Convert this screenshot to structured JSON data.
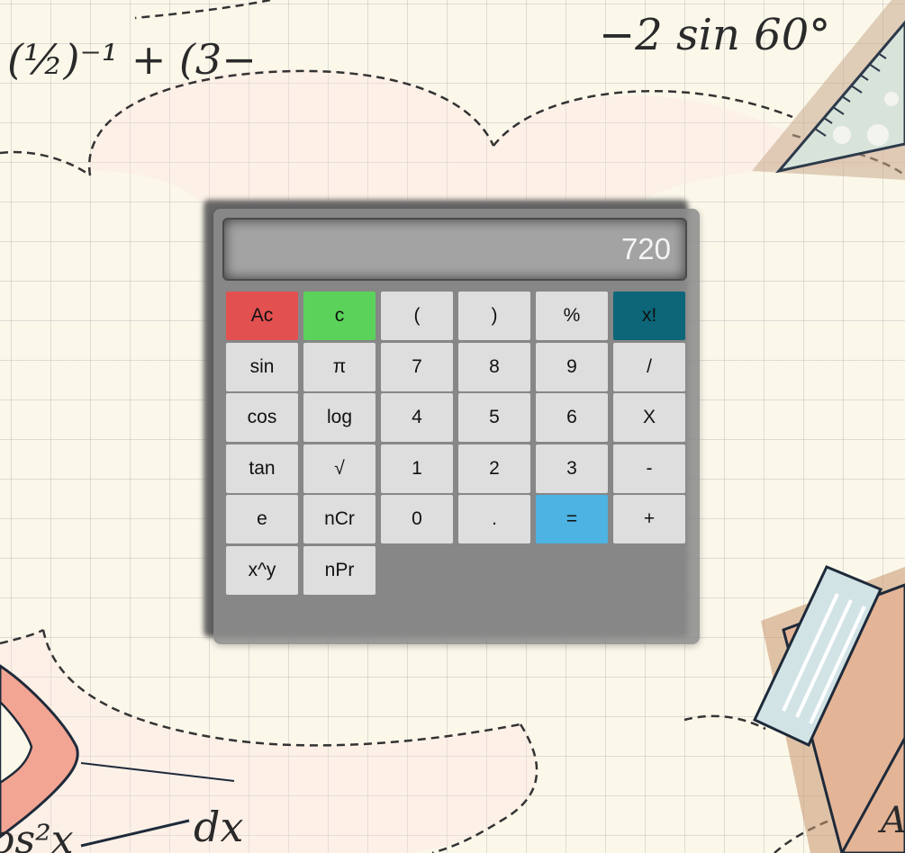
{
  "display": {
    "value": "720"
  },
  "keys": [
    {
      "label": "Ac",
      "name": "clear-all-button",
      "style": "red"
    },
    {
      "label": "c",
      "name": "clear-button",
      "style": "green"
    },
    {
      "label": "(",
      "name": "open-paren-button",
      "style": ""
    },
    {
      "label": ")",
      "name": "close-paren-button",
      "style": ""
    },
    {
      "label": "%",
      "name": "percent-button",
      "style": ""
    },
    {
      "label": "x!",
      "name": "factorial-button",
      "style": "teal"
    },
    {
      "label": "sin",
      "name": "sin-button",
      "style": ""
    },
    {
      "label": "π",
      "name": "pi-button",
      "style": ""
    },
    {
      "label": "7",
      "name": "digit-7-button",
      "style": ""
    },
    {
      "label": "8",
      "name": "digit-8-button",
      "style": ""
    },
    {
      "label": "9",
      "name": "digit-9-button",
      "style": ""
    },
    {
      "label": "/",
      "name": "divide-button",
      "style": ""
    },
    {
      "label": "cos",
      "name": "cos-button",
      "style": ""
    },
    {
      "label": "log",
      "name": "log-button",
      "style": ""
    },
    {
      "label": "4",
      "name": "digit-4-button",
      "style": ""
    },
    {
      "label": "5",
      "name": "digit-5-button",
      "style": ""
    },
    {
      "label": "6",
      "name": "digit-6-button",
      "style": ""
    },
    {
      "label": "X",
      "name": "multiply-button",
      "style": ""
    },
    {
      "label": "tan",
      "name": "tan-button",
      "style": ""
    },
    {
      "label": "√",
      "name": "sqrt-button",
      "style": ""
    },
    {
      "label": "1",
      "name": "digit-1-button",
      "style": ""
    },
    {
      "label": "2",
      "name": "digit-2-button",
      "style": ""
    },
    {
      "label": "3",
      "name": "digit-3-button",
      "style": ""
    },
    {
      "label": "-",
      "name": "subtract-button",
      "style": ""
    },
    {
      "label": "e",
      "name": "euler-button",
      "style": ""
    },
    {
      "label": "nCr",
      "name": "ncr-button",
      "style": ""
    },
    {
      "label": "0",
      "name": "digit-0-button",
      "style": ""
    },
    {
      "label": ".",
      "name": "decimal-button",
      "style": ""
    },
    {
      "label": "=",
      "name": "equals-button",
      "style": "blue"
    },
    {
      "label": "+",
      "name": "add-button",
      "style": ""
    },
    {
      "label": "x^y",
      "name": "power-button",
      "style": ""
    },
    {
      "label": "nPr",
      "name": "npr-button",
      "style": ""
    }
  ],
  "background": {
    "formula_left": "(½)⁻¹ + (3−",
    "formula_right": "−2 sin 60°",
    "formula_bottom": "os²x",
    "formula_bottom_2": "dx",
    "corner_letter": "A"
  },
  "colors": {
    "red": "#e35050",
    "green": "#5bd35b",
    "teal": "#0c6678",
    "blue": "#4cb3e2",
    "key": "#dedede"
  }
}
